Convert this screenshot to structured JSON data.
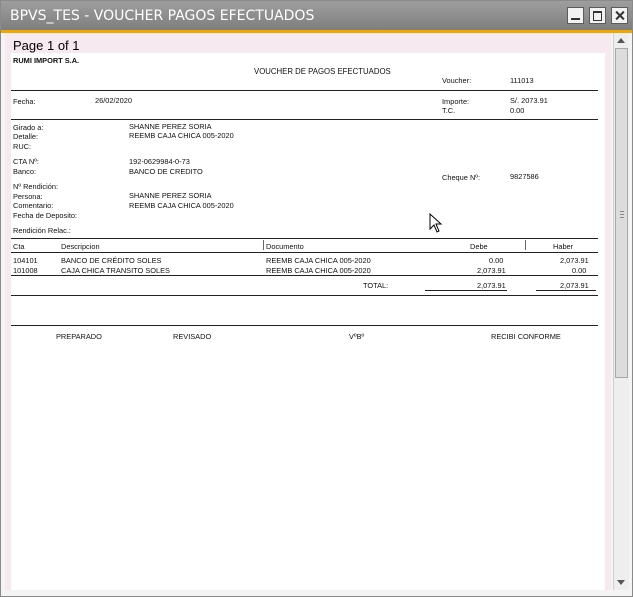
{
  "window": {
    "title": "BPVS_TES - VOUCHER PAGOS EFECTUADOS"
  },
  "viewer": {
    "page_info": "Page 1 of 1"
  },
  "report": {
    "company": "RUMI IMPORT S.A.",
    "title": "VOUCHER DE PAGOS EFECTUADOS",
    "voucher_label": "Voucher:",
    "voucher_value": "111013",
    "fecha_label": "Fecha:",
    "fecha_value": "26/02/2020",
    "importe_label": "Importe:",
    "importe_value": "S/. 2073.91",
    "tc_label": "T.C.",
    "tc_value": "0.00",
    "girado_label": "Girado a:",
    "girado_value": "SHANNE PEREZ SORIA",
    "detalle_label": "Detalle:",
    "detalle_value": "REEMB CAJA CHICA 005-2020",
    "ruc_label": "RUC:",
    "cta_label": "CTA Nº:",
    "cta_value": "192-0629984-0-73",
    "banco_label": "Banco:",
    "banco_value": "BANCO DE CREDITO",
    "cheque_label": "Cheque Nº:",
    "cheque_value": "9827586",
    "rendicion_label": "Nº Rendición:",
    "persona_label": "Persona:",
    "persona_value": "SHANNE PEREZ SORIA",
    "comentario_label": "Comentario:",
    "comentario_value": "REEMB CAJA CHICA 005-2020",
    "fecha_deposito_label": "Fecha de Deposito:",
    "rendicion_relac_label": "Rendición Relac.:",
    "table": {
      "headers": {
        "cta": "Cta",
        "descripcion": "Descripcion",
        "documento": "Documento",
        "debe": "Debe",
        "haber": "Haber"
      },
      "rows": [
        {
          "cta": "104101",
          "descripcion": "BANCO DE CRÉDITO SOLES",
          "documento": "REEMB CAJA CHICA 005-2020",
          "debe": "0.00",
          "haber": "2,073.91"
        },
        {
          "cta": "101008",
          "descripcion": "CAJA CHICA TRANSITO SOLES",
          "documento": "REEMB CAJA CHICA 005-2020",
          "debe": "2,073.91",
          "haber": "0.00"
        }
      ],
      "total_label": "TOTAL:",
      "total_debe": "2,073.91",
      "total_haber": "2,073.91"
    },
    "signatures": {
      "preparado": "PREPARADO",
      "revisado": "REVISADO",
      "vb": "VºBº",
      "recibi": "RECIBI CONFORME"
    }
  },
  "colors": {
    "title_bar": "#8a8a8a",
    "accent": "#f0a800",
    "viewer_bg": "#f7e9f0"
  },
  "icons": {
    "minimize": "minimize-icon",
    "maximize": "maximize-icon",
    "close": "close-icon",
    "cursor": "mouse-cursor-icon"
  }
}
